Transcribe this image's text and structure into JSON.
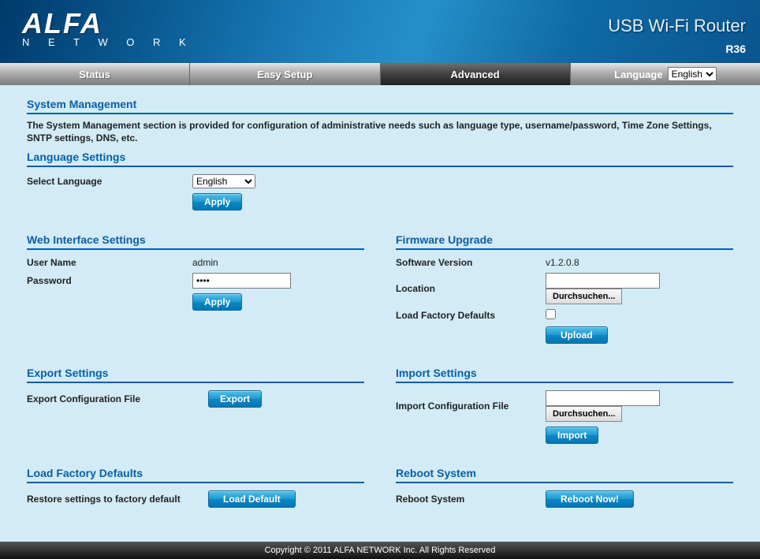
{
  "header": {
    "logo_top": "ALFA",
    "logo_bottom": "N E T W O R K",
    "title": "USB Wi-Fi Router",
    "model": "R36"
  },
  "nav": {
    "status": "Status",
    "easy": "Easy Setup",
    "advanced": "Advanced",
    "language_label": "Language",
    "language_sel": "English"
  },
  "page": {
    "title": "System Management",
    "desc": "The System Management section is provided for configuration of administrative needs such as language type, username/password, Time Zone Settings, SNTP settings, DNS, etc."
  },
  "lang": {
    "title": "Language Settings",
    "label": "Select Language",
    "value": "English",
    "apply": "Apply"
  },
  "web": {
    "title": "Web Interface Settings",
    "user_label": "User Name",
    "user_value": "admin",
    "pass_label": "Password",
    "pass_value": "••••",
    "apply": "Apply"
  },
  "fw": {
    "title": "Firmware Upgrade",
    "ver_label": "Software Version",
    "ver_value": "v1.2.0.8",
    "loc_label": "Location",
    "browse": "Durchsuchen...",
    "factory_label": "Load Factory Defaults",
    "upload": "Upload"
  },
  "exp": {
    "title": "Export Settings",
    "label": "Export Configuration File",
    "btn": "Export"
  },
  "imp": {
    "title": "Import Settings",
    "label": "Import Configuration File",
    "browse": "Durchsuchen...",
    "btn": "Import"
  },
  "factory": {
    "title": "Load Factory Defaults",
    "label": "Restore settings to factory default",
    "btn": "Load Default"
  },
  "reboot": {
    "title": "Reboot System",
    "label": "Reboot System",
    "btn": "Reboot Now!"
  },
  "footer": "Copyright © 2011 ALFA NETWORK Inc. All Rights Reserved"
}
